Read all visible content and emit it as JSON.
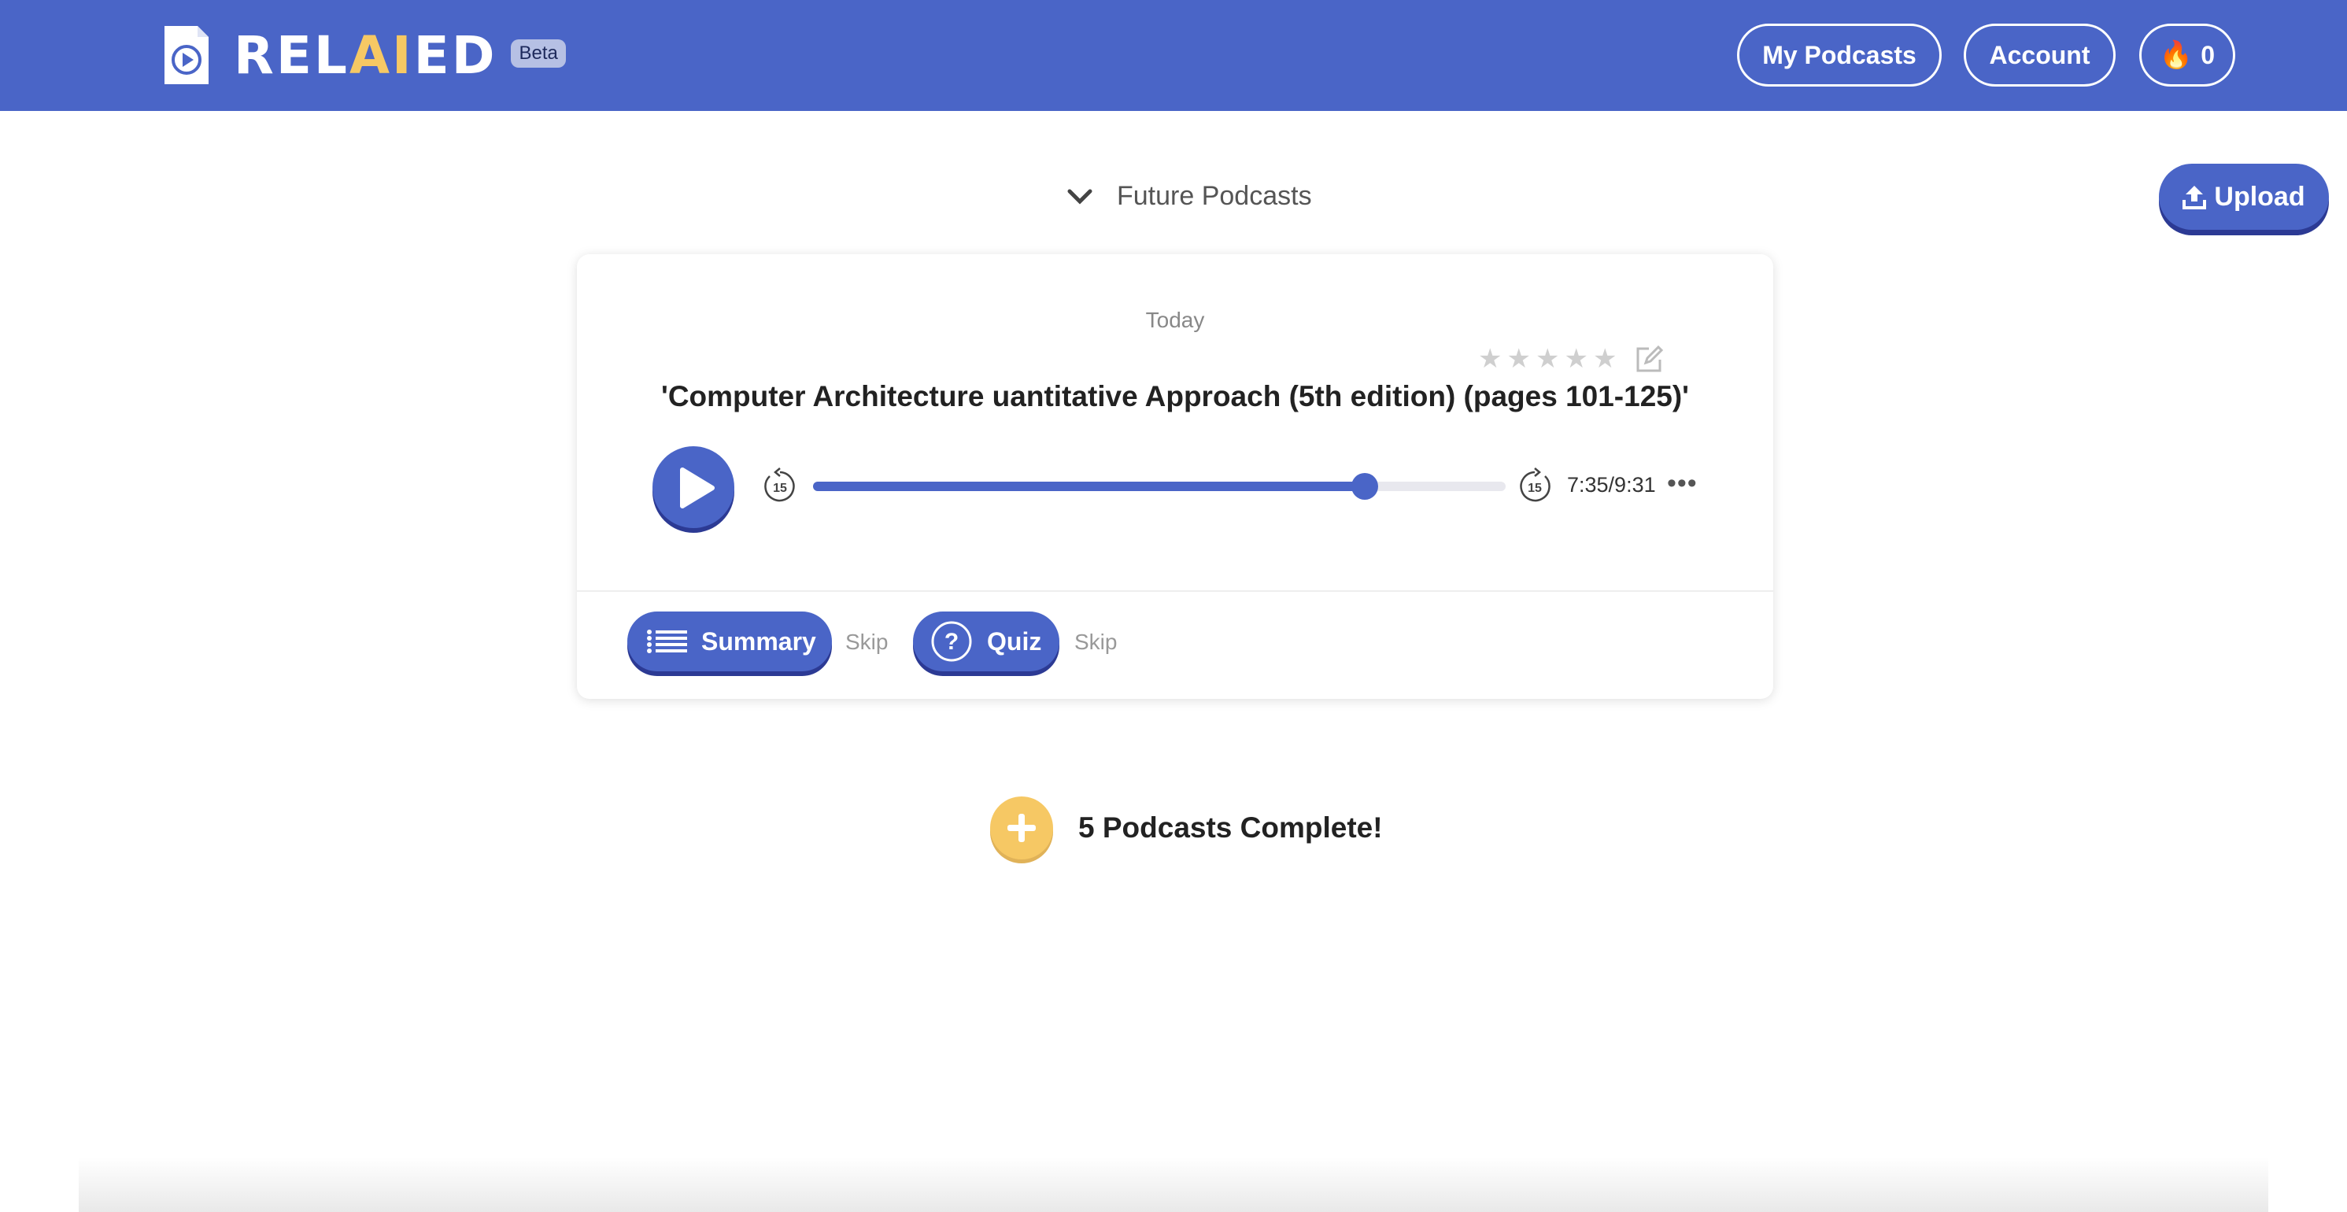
{
  "colors": {
    "brand": "#4a65c7",
    "accent": "#f6c864"
  },
  "header": {
    "logo_pre": "REL",
    "logo_ai": "AI",
    "logo_post": "ED",
    "beta": "Beta",
    "my_podcasts": "My Podcasts",
    "account": "Account",
    "streak_icon": "fire-icon",
    "streak_count": "0"
  },
  "future": {
    "label": "Future Podcasts",
    "icon": "chevron-down-icon"
  },
  "upload": {
    "label": "Upload",
    "icon": "upload-icon"
  },
  "card": {
    "day": "Today",
    "rating": {
      "stars": 0,
      "max": 5
    },
    "title": "'Computer Architecture uantitative Approach (5th edition) (pages 101-125)'",
    "player": {
      "elapsed_seconds": 455,
      "total_seconds": 571,
      "time_text": "7:35/9:31",
      "rewind_label": "15",
      "forward_label": "15",
      "more": "•••"
    },
    "summary_label": "Summary",
    "quiz_label": "Quiz",
    "skip_label": "Skip"
  },
  "complete": {
    "text": "5 Podcasts Complete!"
  }
}
